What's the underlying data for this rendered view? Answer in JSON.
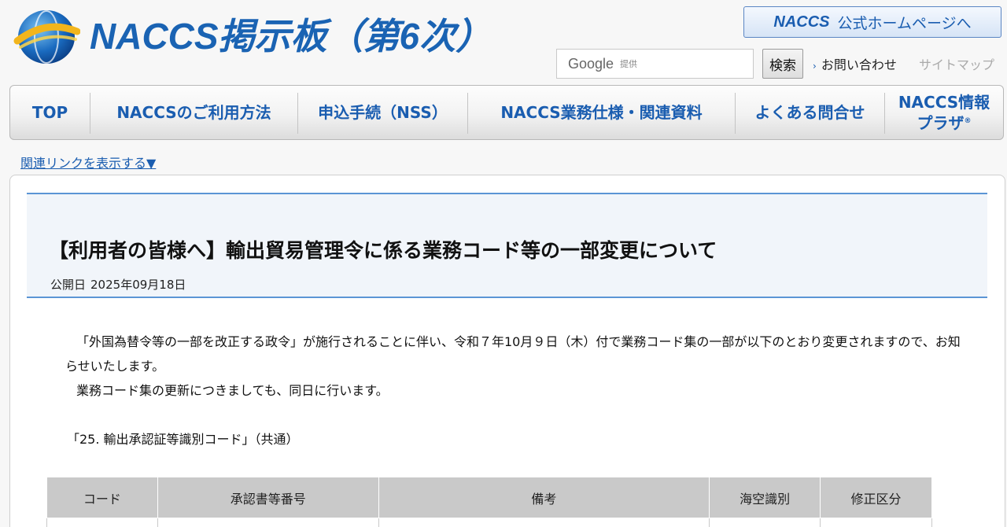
{
  "header": {
    "site_title": "NACCS掲示板（第6次）",
    "official_link": {
      "brand": "NACCS",
      "text": "公式ホームページへ"
    },
    "search": {
      "brand": "Google",
      "provided": "提供",
      "placeholder": "",
      "value": ""
    },
    "search_button": "検索",
    "util_links": {
      "contact": "お問い合わせ",
      "sitemap": "サイトマップ"
    }
  },
  "nav": {
    "items": [
      {
        "label": "TOP"
      },
      {
        "label": "NACCSのご利用方法"
      },
      {
        "label": "申込手続（NSS）"
      },
      {
        "label": "NACCS業務仕様・関連資料"
      },
      {
        "label": "よくある問合せ"
      },
      {
        "label_line1": "NACCS情報",
        "label_line2": "プラザ",
        "mark": "®"
      }
    ]
  },
  "related_link": "関連リンクを表示する▼",
  "article": {
    "title": "【利用者の皆様へ】輸出貿易管理令に係る業務コード等の一部変更について",
    "date_label": "公開日",
    "date_value": "2025年09月18日",
    "paragraph1": "「外国為替令等の一部を改正する政令」が施行されることに伴い、令和７年10月９日（木）付で業務コード集の一部が以下のとおり変更されますので、お知らせいたします。",
    "paragraph2": "業務コード集の更新につきましても、同日に行います。",
    "section_heading": "「25. 輸出承認証等識別コード」（共通）",
    "table": {
      "headers": [
        "コード",
        "承認書等番号",
        "備考",
        "海空識別",
        "修正区分"
      ]
    }
  },
  "colors": {
    "brand_blue": "#1a63b3",
    "title_rule": "#5b95d5",
    "table_header_bg": "#c9c9c9"
  },
  "icons": {
    "logo": "naccs-globe-logo",
    "contact_arrow": "chevron-right-icon"
  }
}
